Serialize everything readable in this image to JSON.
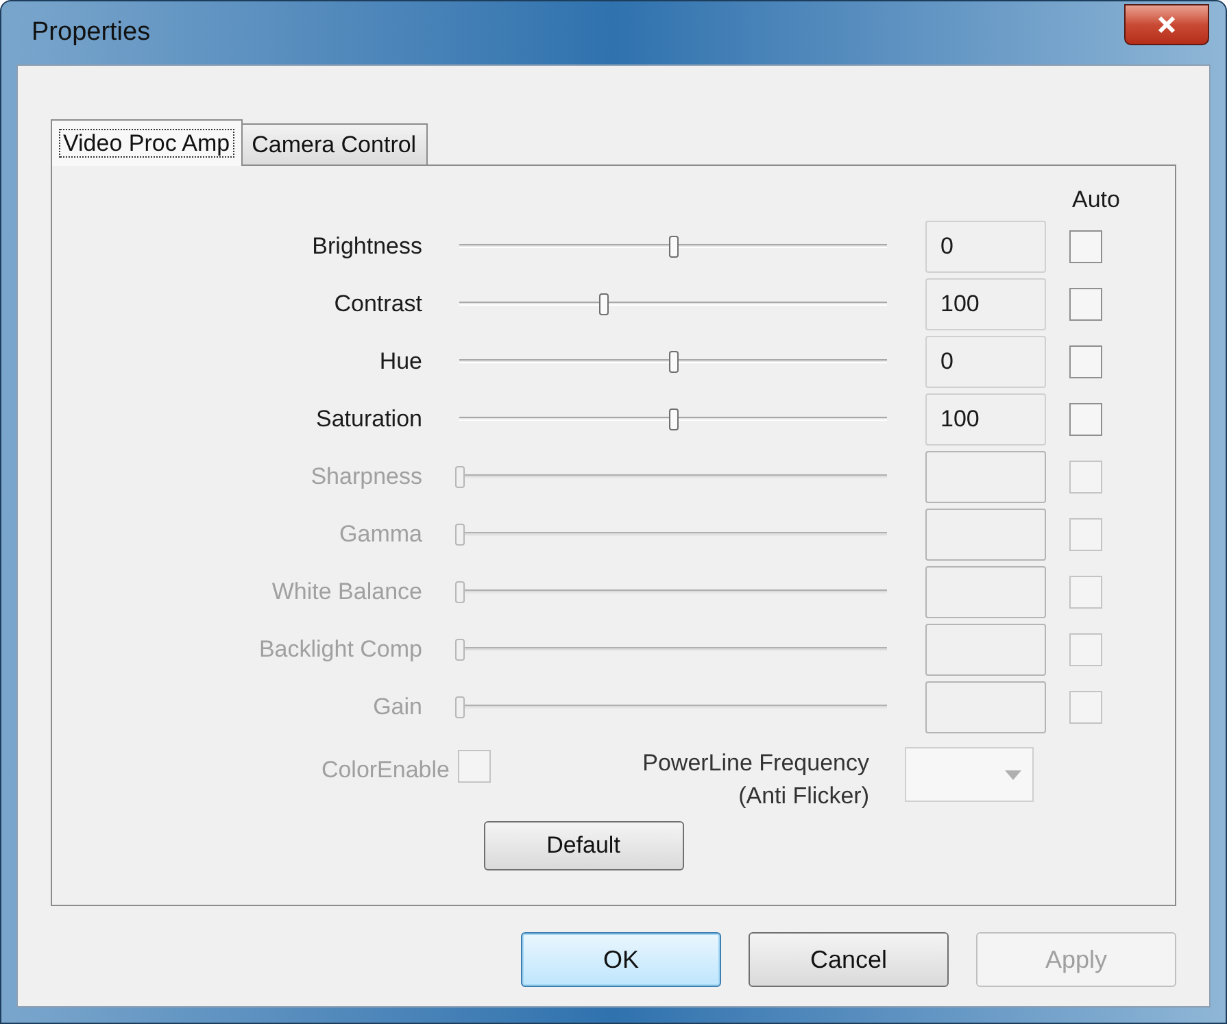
{
  "window": {
    "title": "Properties"
  },
  "tabs": [
    {
      "label": "Video Proc Amp",
      "selected": true
    },
    {
      "label": "Camera Control",
      "selected": false
    }
  ],
  "auto_header": "Auto",
  "controls": [
    {
      "label": "Brightness",
      "level": 0.5,
      "value": "0",
      "disabled": false,
      "auto": false
    },
    {
      "label": "Contrast",
      "level": 0.335,
      "value": "100",
      "disabled": false,
      "auto": false
    },
    {
      "label": "Hue",
      "level": 0.5,
      "value": "0",
      "disabled": false,
      "auto": false
    },
    {
      "label": "Saturation",
      "level": 0.5,
      "value": "100",
      "disabled": false,
      "auto": false
    },
    {
      "label": "Sharpness",
      "level": 0,
      "disabled": true,
      "auto": false
    },
    {
      "label": "Gamma",
      "level": 0,
      "disabled": true,
      "auto": false
    },
    {
      "label": "White Balance",
      "level": 0,
      "disabled": true,
      "auto": false
    },
    {
      "label": "Backlight Comp",
      "level": 0,
      "disabled": true,
      "auto": false
    },
    {
      "label": "Gain",
      "level": 0,
      "disabled": true,
      "auto": false
    }
  ],
  "color_enable": {
    "label": "ColorEnable",
    "checked": false,
    "disabled": true
  },
  "powerline": {
    "label": "PowerLine Frequency\n(Anti Flicker)",
    "disabled": true
  },
  "default_button": {
    "label": "Default"
  },
  "buttons": [
    {
      "label": "OK",
      "kind": "default",
      "disabled": false
    },
    {
      "label": "Cancel",
      "kind": "normal",
      "disabled": false
    },
    {
      "label": "Apply",
      "kind": "normal",
      "disabled": true
    }
  ]
}
